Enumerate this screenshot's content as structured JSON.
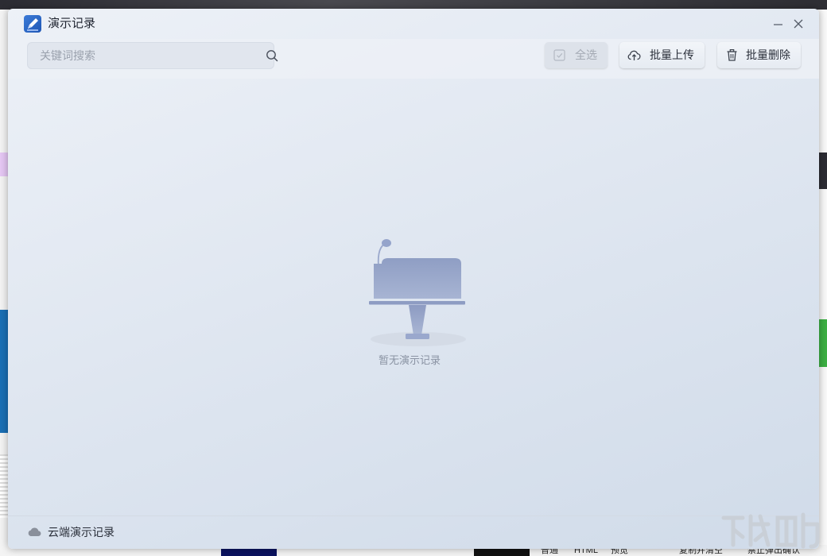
{
  "window": {
    "title": "演示记录",
    "controls": {
      "minimize_icon": "minimize-icon",
      "close_icon": "close-icon"
    }
  },
  "toolbar": {
    "search": {
      "placeholder": "关键词搜索",
      "value": "",
      "icon": "search-icon"
    },
    "select_all": {
      "label": "全选",
      "icon": "checkbox-icon",
      "enabled": false
    },
    "batch_upload": {
      "label": "批量上传",
      "icon": "cloud-upload-icon"
    },
    "batch_delete": {
      "label": "批量删除",
      "icon": "trash-icon"
    }
  },
  "main": {
    "empty_state": {
      "text": "暂无演示记录",
      "icon": "podium-microphone-icon"
    }
  },
  "footer": {
    "cloud_records": {
      "label": "云端演示记录",
      "icon": "cloud-icon"
    }
  },
  "background": {
    "bottom_texts": [
      "普通",
      "HTML",
      "预览",
      "复制并清空",
      "禁止弹出确认"
    ]
  },
  "colors": {
    "accent": "#2f6bd0",
    "window_bg": "#e0e7f1",
    "illustration": "#93a2c6",
    "muted_text": "#8a93a3"
  }
}
